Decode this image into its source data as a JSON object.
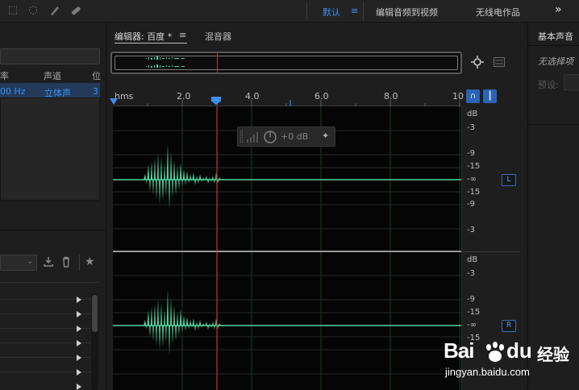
{
  "topbar": {
    "workspaces": [
      "默认",
      "编辑音频到视频",
      "无线电作品"
    ],
    "menu_glyph": "≡",
    "more_glyph": "»"
  },
  "left_panel": {
    "columns": [
      "率",
      "声道",
      "位"
    ],
    "row": [
      "00 Hz",
      "立体声",
      "3"
    ]
  },
  "editor": {
    "tab_editor": "编辑器: 百度 *",
    "tab_menu": "≡",
    "tab_mixer": "混音器",
    "ruler_labels": [
      "hms",
      "2.0",
      "4.0",
      "6.0",
      "8.0",
      "10"
    ],
    "hud_gain": "+0 dB",
    "db_labels_top": [
      "dB",
      "-3",
      "-9",
      "-15",
      "-∞",
      "-15",
      "-9",
      "-3"
    ],
    "db_labels_bottom": [
      "dB",
      "-3",
      "-9",
      "-15",
      "-∞",
      "-15"
    ],
    "channel_left": "L",
    "channel_right": "R"
  },
  "right_panel": {
    "title": "基本声音",
    "empty": "无选择项",
    "preset_label": "预设:"
  },
  "watermark": {
    "brand": "Bai",
    "brand2": "du",
    "cn": "经验",
    "url": "jingyan.baidu.com"
  },
  "colors": {
    "accent": "#3a8ff0",
    "waveform": "#4fd6a0",
    "playhead": "#c0392b"
  }
}
